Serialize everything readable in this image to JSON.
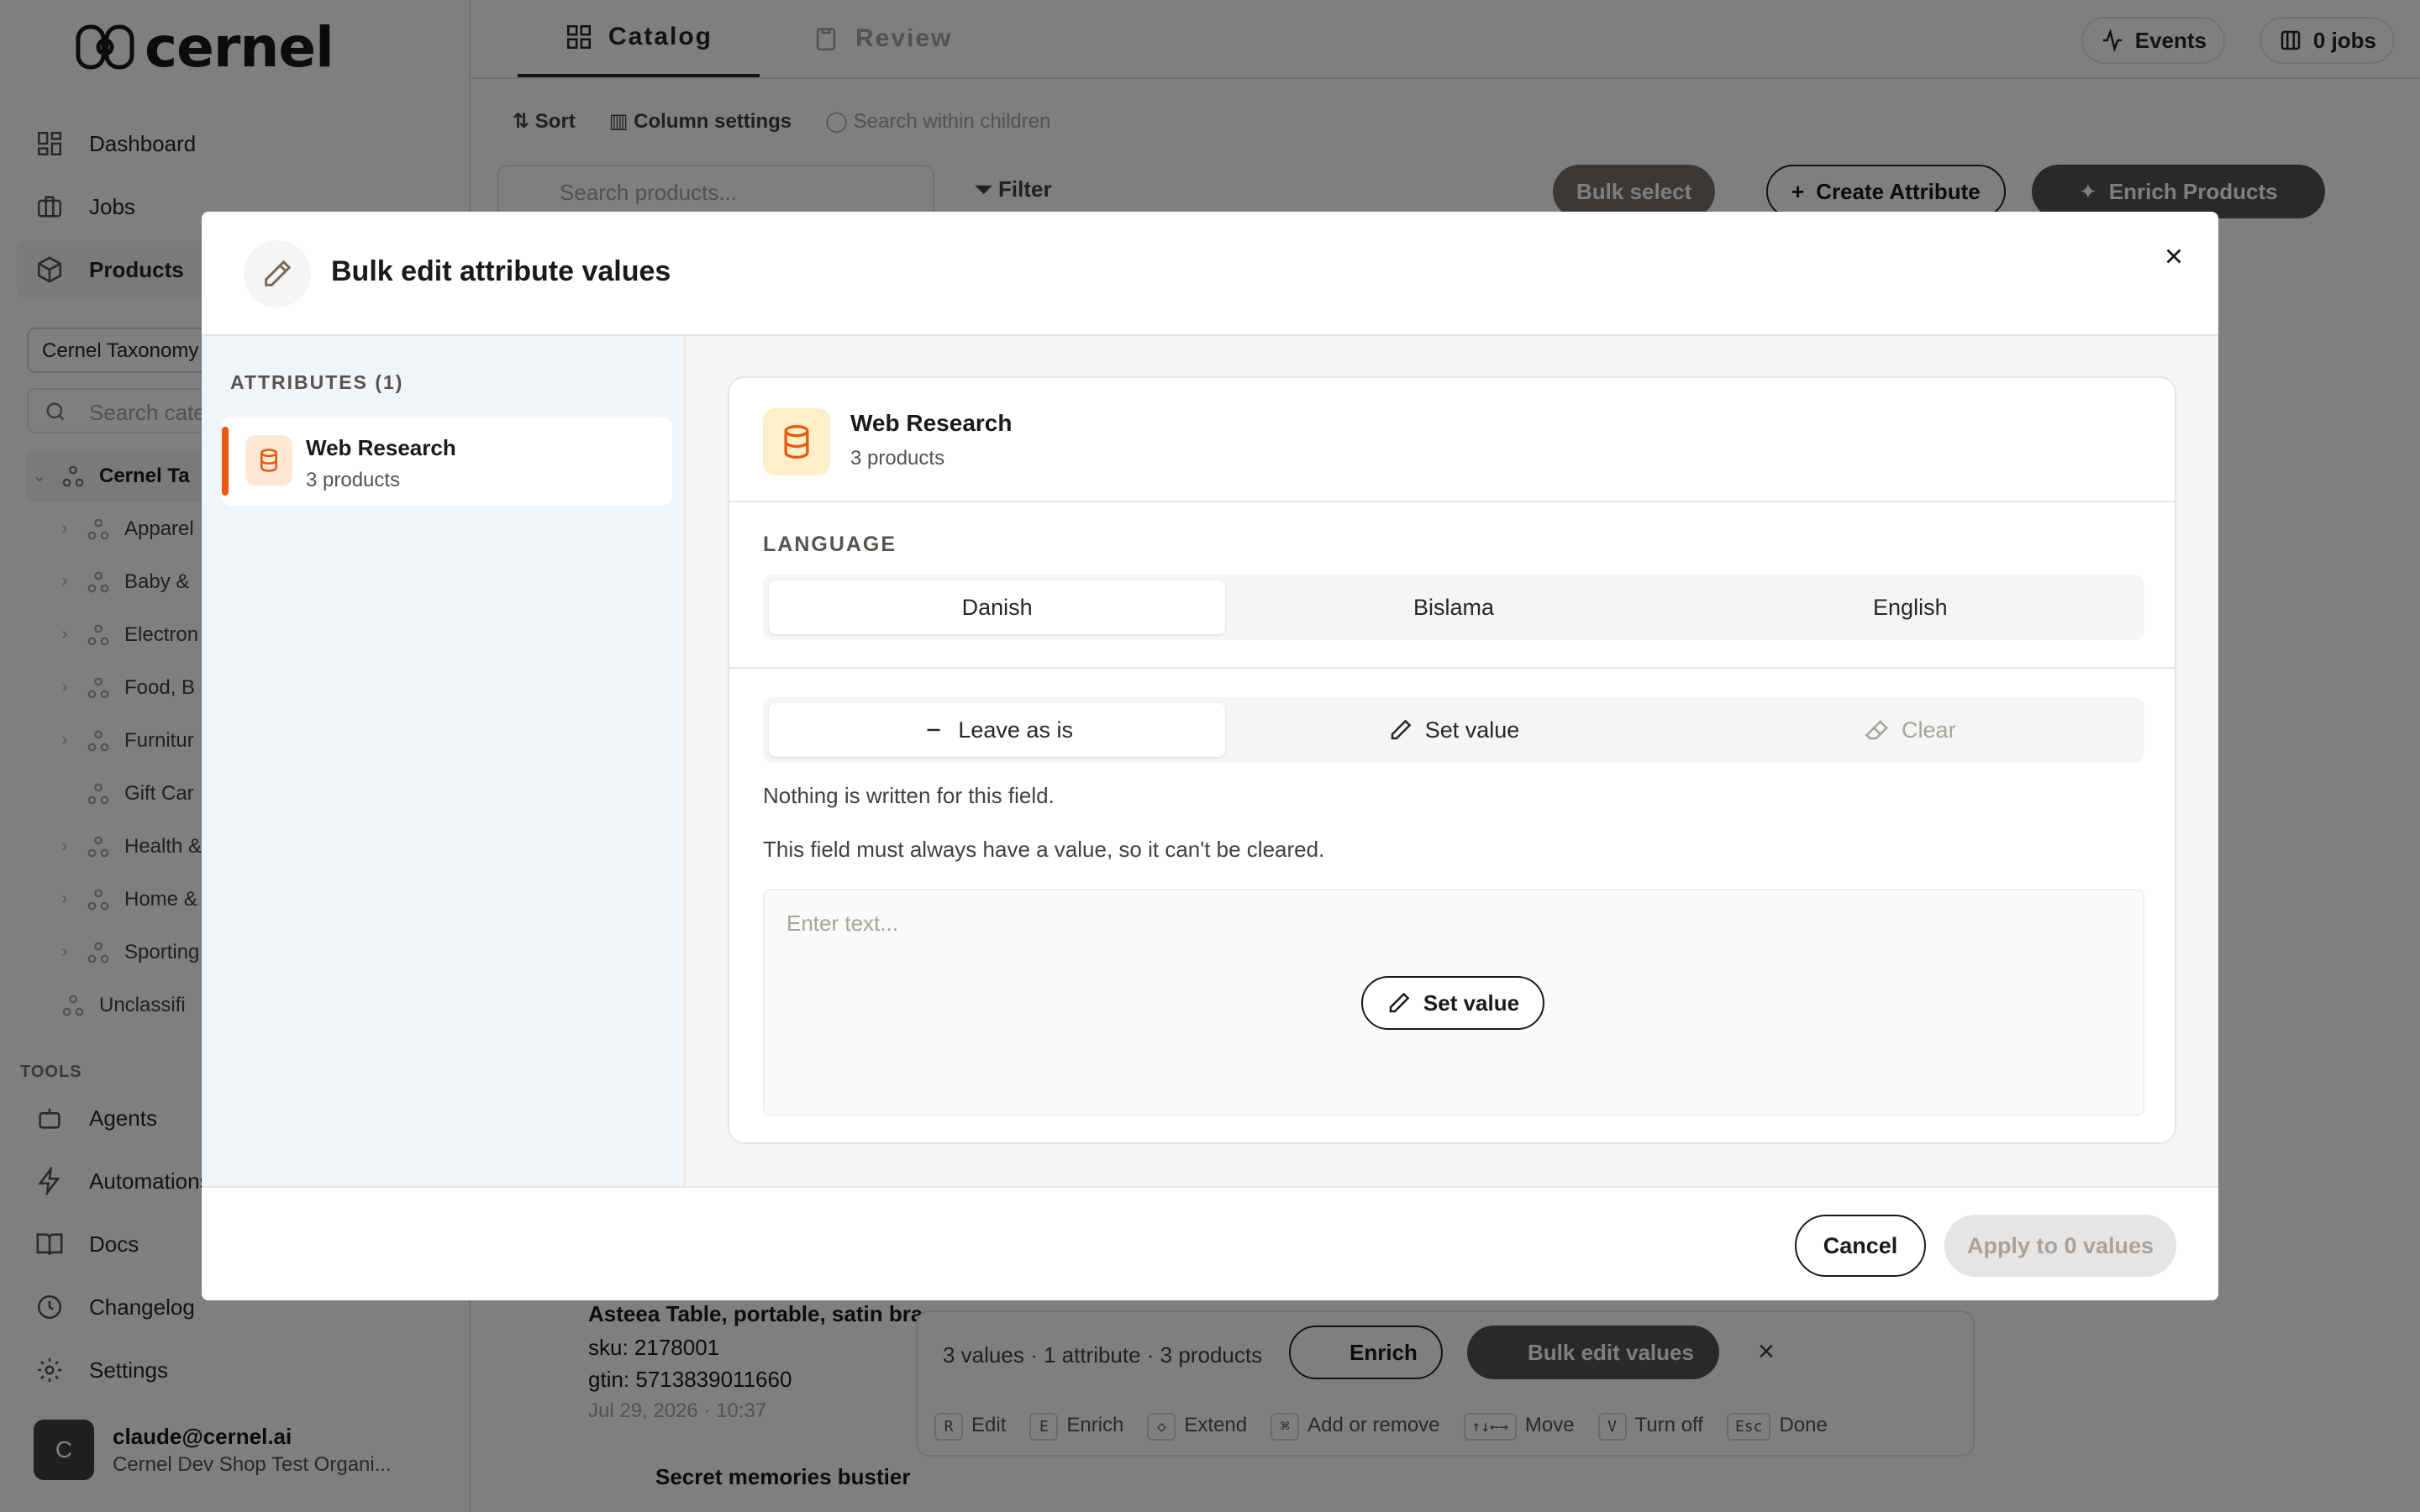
{
  "app": {
    "logo_text": "cernel",
    "nav": [
      {
        "label": "Dashboard",
        "icon": "grid-icon"
      },
      {
        "label": "Jobs",
        "icon": "briefcase-icon"
      },
      {
        "label": "Products",
        "icon": "box-icon"
      }
    ],
    "taxonomy_select": "Cernel Taxonomy",
    "category_search_placeholder": "Search cate",
    "tree": [
      {
        "label": "Cernel Ta",
        "root": true
      },
      {
        "label": "Apparel"
      },
      {
        "label": "Baby &"
      },
      {
        "label": "Electron"
      },
      {
        "label": "Food, B"
      },
      {
        "label": "Furnitur"
      },
      {
        "label": "Gift Car"
      },
      {
        "label": "Health &"
      },
      {
        "label": "Home &"
      },
      {
        "label": "Sporting"
      },
      {
        "label": "Unclassifi"
      }
    ],
    "tools_label": "TOOLS",
    "tools": [
      {
        "label": "Agents"
      },
      {
        "label": "Automations"
      },
      {
        "label": "Docs"
      },
      {
        "label": "Changelog"
      },
      {
        "label": "Settings"
      }
    ],
    "user": {
      "initial": "C",
      "email": "claude@cernel.ai",
      "org": "Cernel Dev Shop Test Organi..."
    }
  },
  "topbar": {
    "tabs": [
      "Catalog",
      "Review"
    ],
    "events_label": "Events",
    "jobs_label": "0 jobs"
  },
  "toolbar": {
    "sort": "Sort",
    "column_settings": "Column settings",
    "search_children": "Search within children",
    "search_placeholder": "Search products...",
    "filter": "Filter",
    "bulk_select": "Bulk select",
    "create_attribute": "Create Attribute",
    "enrich_products": "Enrich Products"
  },
  "background_rows": {
    "row1_title": "Asteea Table, portable, satin bra",
    "row1_sku": "sku: 2178001",
    "row1_gtin": "gtin: 5713839011660",
    "row1_date": "Jul 29, 2026 · 10:37",
    "row2_title": "Secret memories bustier"
  },
  "bottom_bar": {
    "summary": "3 values · 1 attribute · 3 products",
    "enrich": "Enrich",
    "bulk_edit": "Bulk edit values",
    "shortcuts": [
      {
        "key": "R",
        "label": "Edit"
      },
      {
        "key": "E",
        "label": "Enrich"
      },
      {
        "key": "◇",
        "label": "Extend"
      },
      {
        "key": "⌘",
        "label": "Add or remove"
      },
      {
        "key": "↑↓←→",
        "label": "Move"
      },
      {
        "key": "V",
        "label": "Turn off"
      },
      {
        "key": "Esc",
        "label": "Done"
      }
    ]
  },
  "modal": {
    "title": "Bulk edit attribute values",
    "attributes_label": "ATTRIBUTES (1)",
    "attribute": {
      "name": "Web Research",
      "count": "3 products"
    },
    "card": {
      "name": "Web Research",
      "count": "3 products"
    },
    "language_label": "LANGUAGE",
    "languages": [
      "Danish",
      "Bislama",
      "English"
    ],
    "modes": [
      "Leave as is",
      "Set value",
      "Clear"
    ],
    "info_1": "Nothing is written for this field.",
    "info_2": "This field must always have a value, so it can't be cleared.",
    "textarea_placeholder": "Enter text...",
    "set_value_button": "Set value",
    "cancel": "Cancel",
    "apply": "Apply to 0 values"
  },
  "colors": {
    "accent": "#ea580c",
    "overlay": "rgba(0,0,0,0.5)",
    "panel_bg": "#f1f5f9"
  }
}
